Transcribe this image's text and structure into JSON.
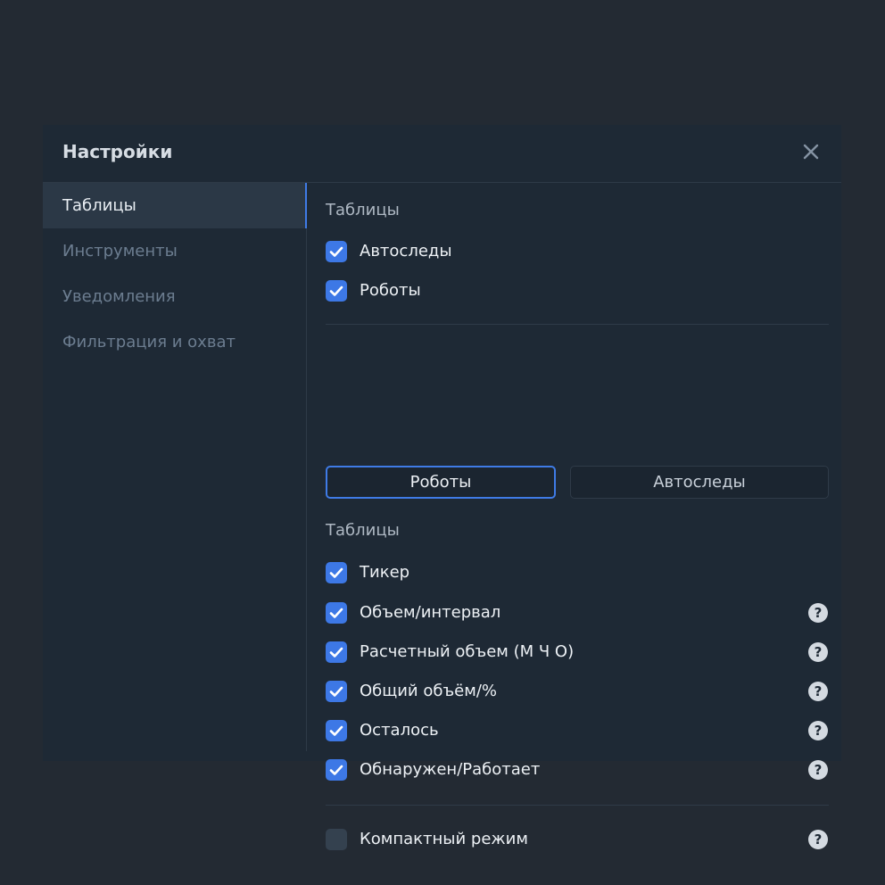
{
  "dialog": {
    "title": "Настройки",
    "close_icon": "close-icon"
  },
  "sidebar": {
    "items": [
      {
        "label": "Таблицы",
        "active": true
      },
      {
        "label": "Инструменты",
        "active": false
      },
      {
        "label": "Уведомления",
        "active": false
      },
      {
        "label": "Фильтрация и охват",
        "active": false
      }
    ]
  },
  "content": {
    "section1": {
      "title": "Таблицы",
      "options": [
        {
          "label": "Автоследы",
          "checked": true
        },
        {
          "label": "Роботы",
          "checked": true
        }
      ]
    },
    "tabs": [
      {
        "label": "Роботы",
        "active": true
      },
      {
        "label": "Автоследы",
        "active": false
      }
    ],
    "section2": {
      "title": "Таблицы",
      "options": [
        {
          "label": "Тикер",
          "checked": true,
          "help": false
        },
        {
          "label": "Объем/интервал",
          "checked": true,
          "help": true
        },
        {
          "label": "Расчетный объем (М Ч О)",
          "checked": true,
          "help": true
        },
        {
          "label": "Общий объём/%",
          "checked": true,
          "help": true
        },
        {
          "label": "Осталось",
          "checked": true,
          "help": true
        },
        {
          "label": "Обнаружен/Работает",
          "checked": true,
          "help": true
        }
      ]
    },
    "compact": {
      "label": "Компактный режим",
      "checked": false,
      "help": true
    }
  },
  "colors": {
    "background": "#232a33",
    "dialog": "#1e2935",
    "accent": "#3f7be6",
    "checkbox_on": "#3d78e6",
    "checkbox_off": "#34414f"
  }
}
